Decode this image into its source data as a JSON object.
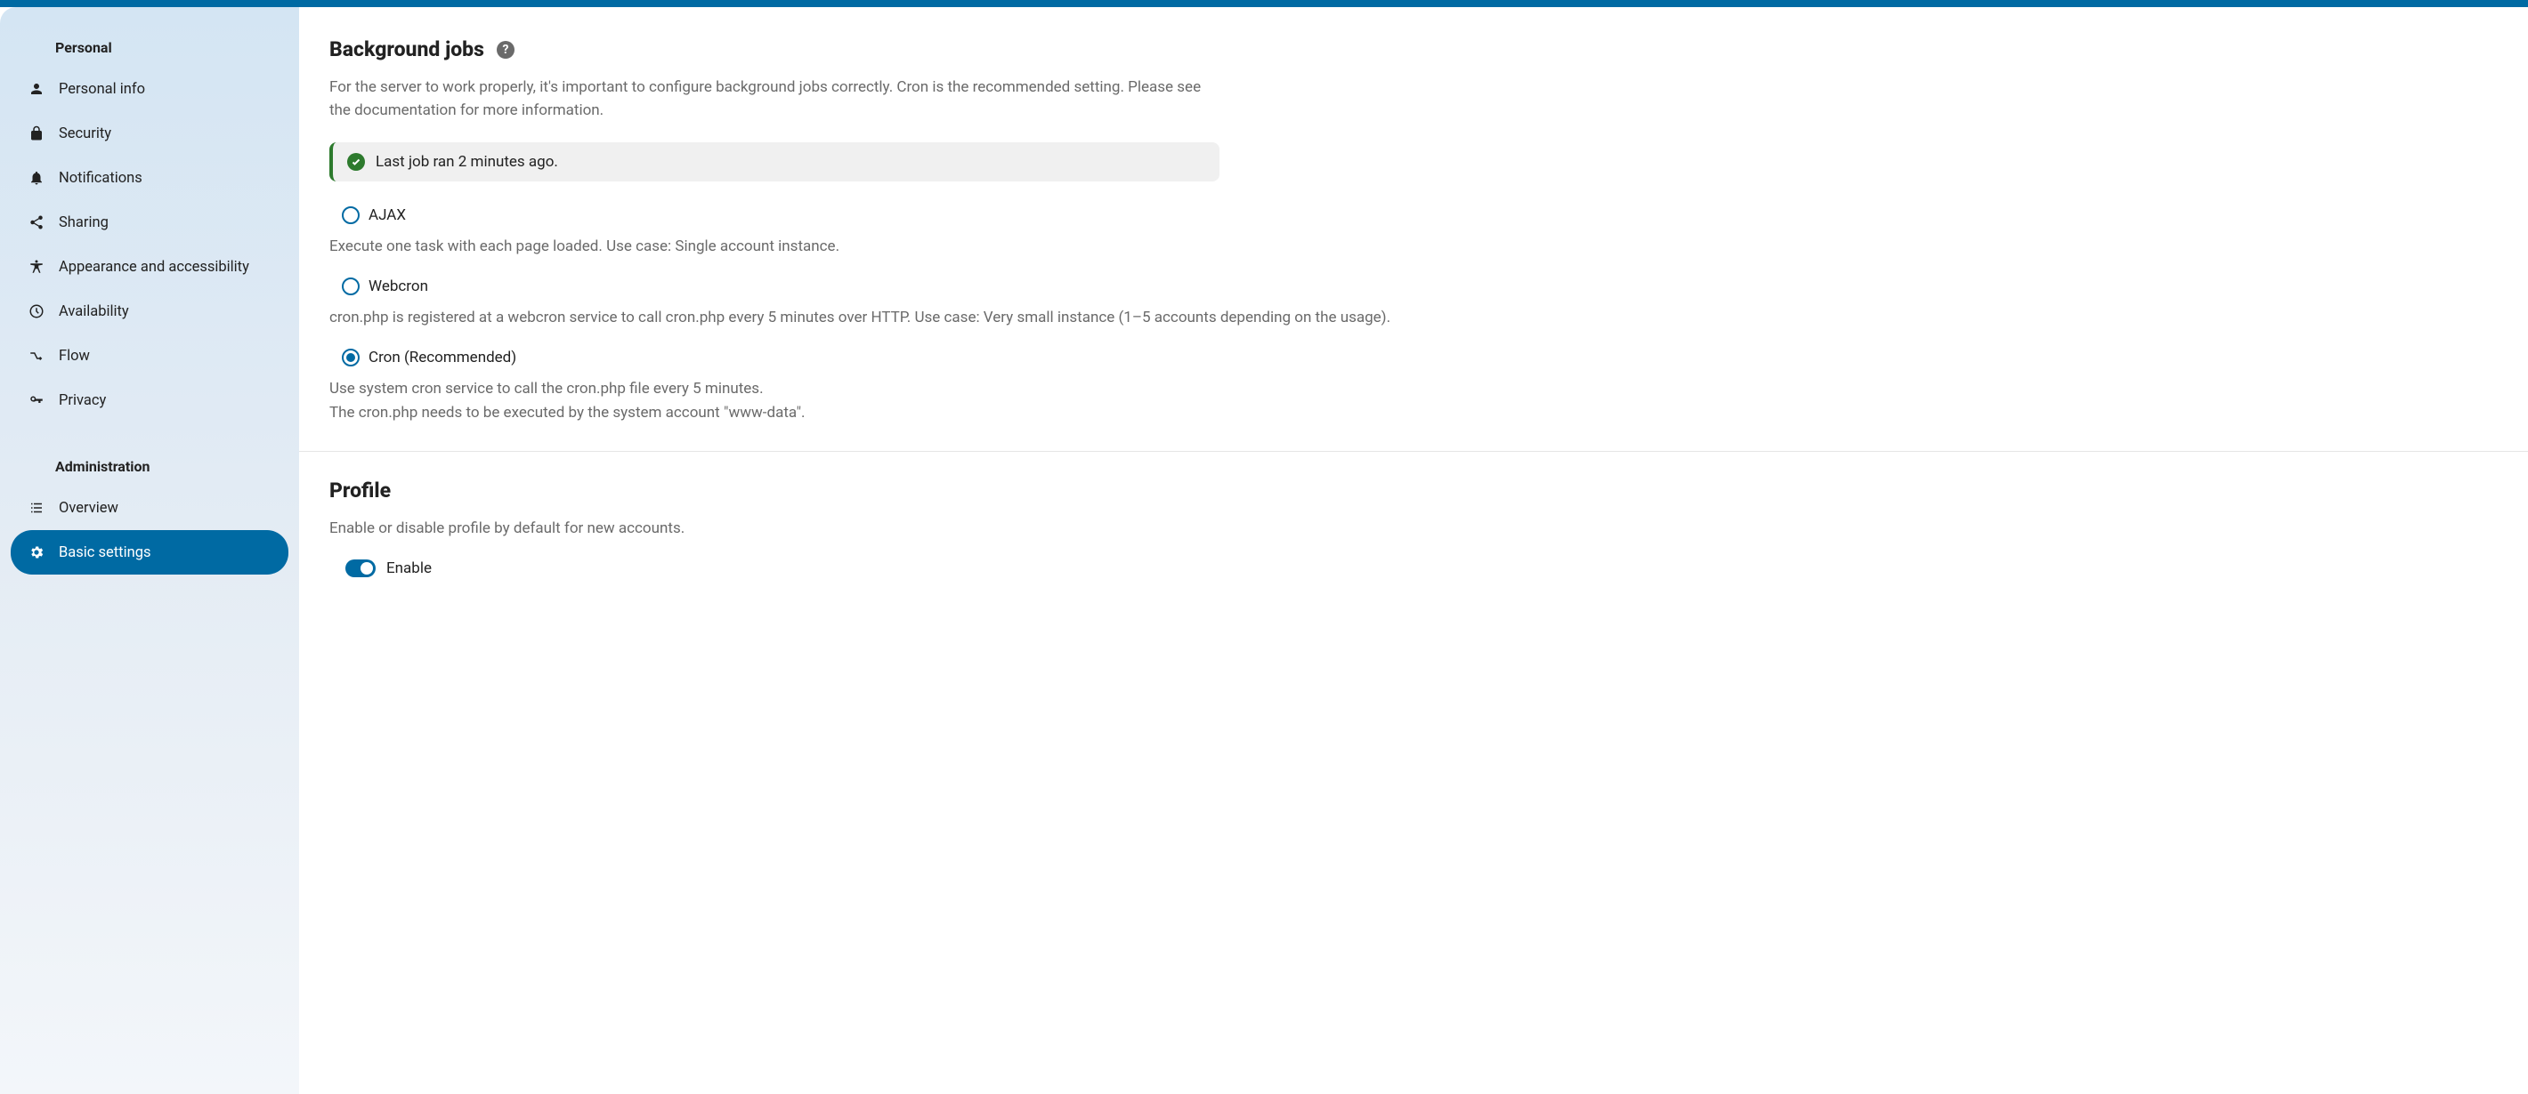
{
  "sidebar": {
    "personal_heading": "Personal",
    "admin_heading": "Administration",
    "items": {
      "personal_info": "Personal info",
      "security": "Security",
      "notifications": "Notifications",
      "sharing": "Sharing",
      "appearance": "Appearance and accessibility",
      "availability": "Availability",
      "flow": "Flow",
      "privacy": "Privacy",
      "overview": "Overview",
      "basic_settings": "Basic settings"
    }
  },
  "bgjobs": {
    "title": "Background jobs",
    "help_glyph": "?",
    "desc": "For the server to work properly, it's important to configure background jobs correctly. Cron is the recommended setting. Please see the documentation for more information.",
    "status": "Last job ran 2 minutes ago.",
    "ajax_label": "AJAX",
    "ajax_desc": "Execute one task with each page loaded. Use case: Single account instance.",
    "webcron_label": "Webcron",
    "webcron_desc": "cron.php is registered at a webcron service to call cron.php every 5 minutes over HTTP. Use case: Very small instance (1–5 accounts depending on the usage).",
    "cron_label": "Cron (Recommended)",
    "cron_desc": "Use system cron service to call the cron.php file every 5 minutes.\nThe cron.php needs to be executed by the system account \"www-data\"."
  },
  "profile": {
    "title": "Profile",
    "desc": "Enable or disable profile by default for new accounts.",
    "enable_label": "Enable"
  }
}
